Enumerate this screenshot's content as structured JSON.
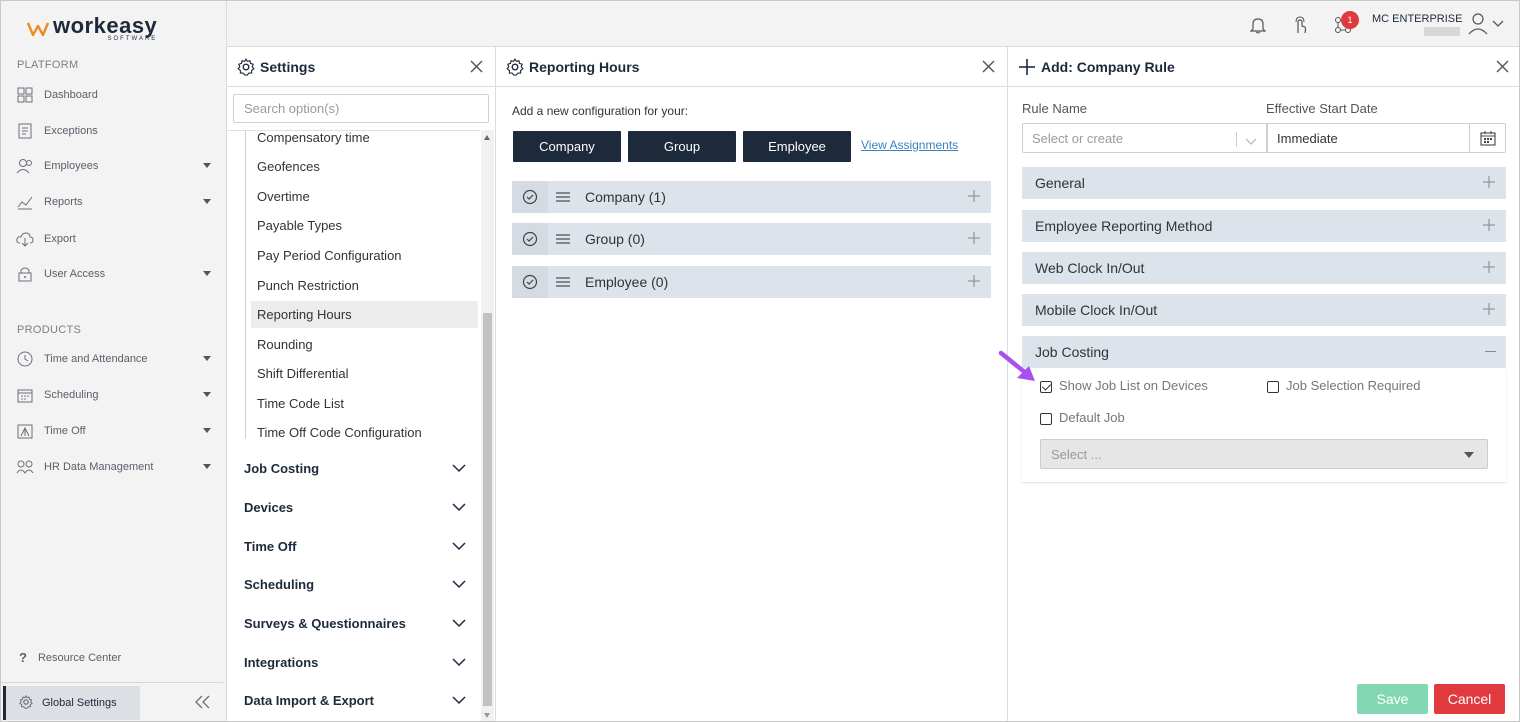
{
  "logo": {
    "name": "workeasy",
    "sub": "SOFTWARE"
  },
  "nav": {
    "platform_label": "PLATFORM",
    "platform_items": [
      {
        "label": "Dashboard",
        "icon": "dashboard-icon"
      },
      {
        "label": "Exceptions",
        "icon": "exceptions-icon"
      },
      {
        "label": "Employees",
        "icon": "employees-icon"
      },
      {
        "label": "Reports",
        "icon": "reports-icon"
      },
      {
        "label": "Export",
        "icon": "export-icon"
      },
      {
        "label": "User Access",
        "icon": "lock-icon"
      }
    ],
    "products_label": "PRODUCTS",
    "product_items": [
      {
        "label": "Time and Attendance",
        "icon": "clock-icon"
      },
      {
        "label": "Scheduling",
        "icon": "calendar-icon"
      },
      {
        "label": "Time Off",
        "icon": "time-off-icon"
      },
      {
        "label": "HR Data Management",
        "icon": "hr-icon"
      }
    ],
    "resource_center": "Resource Center",
    "global_settings": "Global Settings"
  },
  "topbar": {
    "notification_count": "1",
    "org_name": "MC ENTERPRISE"
  },
  "settings_panel": {
    "title": "Settings",
    "search_placeholder": "Search option(s)",
    "sub_items": [
      "Compensatory time",
      "Geofences",
      "Overtime",
      "Payable Types",
      "Pay Period Configuration",
      "Punch Restriction",
      "Reporting Hours",
      "Rounding",
      "Shift Differential",
      "Time Code List",
      "Time Off Code Configuration"
    ],
    "active_item": "Reporting Hours",
    "groups": [
      "Job Costing",
      "Devices",
      "Time Off",
      "Scheduling",
      "Surveys & Questionnaires",
      "Integrations",
      "Data Import & Export"
    ]
  },
  "reporting_panel": {
    "title": "Reporting Hours",
    "add_config_text": "Add a new configuration for your:",
    "buttons": {
      "company": "Company",
      "group": "Group",
      "employee": "Employee"
    },
    "view_assignments": "View Assignments",
    "rows": [
      "Company (1)",
      "Group (0)",
      "Employee (0)"
    ]
  },
  "rule_panel": {
    "title": "Add: Company Rule",
    "rule_name_label": "Rule Name",
    "rule_name_placeholder": "Select or create",
    "start_date_label": "Effective Start Date",
    "start_date_value": "Immediate",
    "sections": [
      "General",
      "Employee Reporting Method",
      "Web Clock In/Out",
      "Mobile Clock In/Out",
      "Job Costing"
    ],
    "job_costing": {
      "show_job_list": "Show Job List on Devices",
      "show_job_list_checked": true,
      "job_selection_required": "Job Selection Required",
      "job_selection_required_checked": false,
      "default_job": "Default Job",
      "default_job_checked": false,
      "select_placeholder": "Select ..."
    },
    "save": "Save",
    "cancel": "Cancel"
  },
  "colors": {
    "navy": "#1d2a3b",
    "accordion": "#dde3ea",
    "save": "#82d7b3",
    "cancel": "#e0393e",
    "link": "#3b82c4",
    "annotation_arrow": "#a84ff0"
  }
}
